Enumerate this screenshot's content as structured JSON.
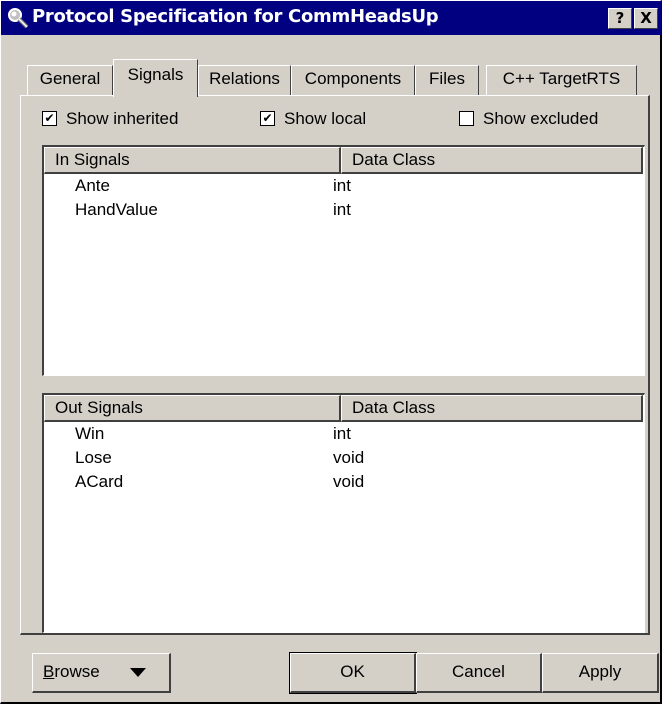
{
  "window": {
    "title": "Protocol Specification for CommHeadsUp",
    "help_glyph": "?",
    "close_glyph": "X"
  },
  "tabs": [
    {
      "label": "General",
      "active": false
    },
    {
      "label": "Signals",
      "active": true
    },
    {
      "label": "Relations",
      "active": false
    },
    {
      "label": "Components",
      "active": false
    },
    {
      "label": "Files",
      "active": false
    },
    {
      "label": "C++ TargetRTS",
      "active": false
    }
  ],
  "checkboxes": [
    {
      "label": "Show inherited",
      "checked": true
    },
    {
      "label": "Show local",
      "checked": true
    },
    {
      "label": "Show excluded",
      "checked": false
    }
  ],
  "in_signals": {
    "columns": [
      "In Signals",
      "Data Class"
    ],
    "rows": [
      {
        "name": "Ante",
        "data_class": "int"
      },
      {
        "name": "HandValue",
        "data_class": "int"
      }
    ]
  },
  "out_signals": {
    "columns": [
      "Out Signals",
      "Data Class"
    ],
    "rows": [
      {
        "name": "Win",
        "data_class": "int"
      },
      {
        "name": "Lose",
        "data_class": "void"
      },
      {
        "name": "ACard",
        "data_class": "void"
      }
    ]
  },
  "buttons": {
    "browse_first": "B",
    "browse_rest": "rowse",
    "ok": "OK",
    "cancel": "Cancel",
    "apply": "Apply"
  },
  "icons": {
    "app": "magnifier-icon",
    "check": "✔",
    "dropdown": "chevron-down-icon"
  }
}
